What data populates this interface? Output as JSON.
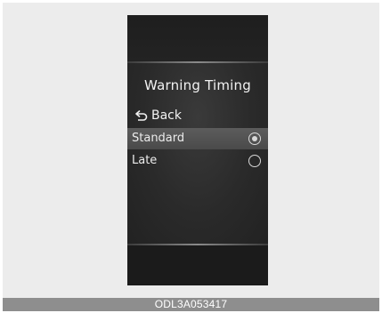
{
  "screen": {
    "title": "Warning Timing",
    "back_label": "Back",
    "back_icon": "back-arrow-icon",
    "options": [
      {
        "label": "Standard",
        "selected": true
      },
      {
        "label": "Late",
        "selected": false
      }
    ]
  },
  "caption": "ODL3A053417",
  "colors": {
    "screen_background": "#1d1d1d",
    "highlight": "#555555",
    "caption_bar": "#8e8e8e"
  }
}
